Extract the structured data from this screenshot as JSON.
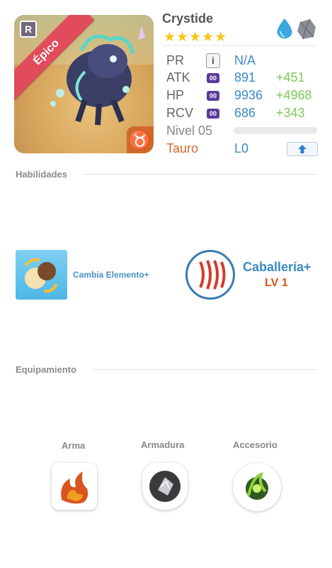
{
  "unit": {
    "name": "Crystide",
    "rarity": "Épico",
    "rarity_icon": "R",
    "stars": "★★★★★",
    "zodiac_glyph": "♉",
    "elements": [
      "water-drop-icon",
      "rock-icon"
    ]
  },
  "stats": {
    "pr_label": "PR",
    "pr_info": "i",
    "pr_value": "N/A",
    "atk_label": "ATK",
    "atk_badge": "00",
    "atk_value": "891",
    "atk_plus": "+451",
    "hp_label": "HP",
    "hp_badge": "00",
    "hp_value": "9936",
    "hp_plus": "+4968",
    "rcv_label": "RCV",
    "rcv_badge": "00",
    "rcv_value": "686",
    "rcv_plus": "+343",
    "level_label": "Nivel 05",
    "level_progress": 0,
    "zodiac_label": "Tauro",
    "zodiac_level": "L0"
  },
  "abilities": {
    "title": "Habilidades",
    "active_skill": "Cambia Elemento+",
    "leader_skill": "Caballería+",
    "leader_level": "LV 1"
  },
  "equipment": {
    "title": "Equipamiento",
    "slots": [
      {
        "label": "Arma",
        "icon": "weapon-flame-icon"
      },
      {
        "label": "Armadura",
        "icon": "armor-shield-icon"
      },
      {
        "label": "Accesorio",
        "icon": "accessory-gem-icon"
      }
    ]
  },
  "colors": {
    "ribbon": "#e24b59",
    "stat_value": "#3a8ac4",
    "stat_plus": "#7dc957",
    "zodiac": "#d06a2a",
    "leader_level": "#e0501c"
  }
}
